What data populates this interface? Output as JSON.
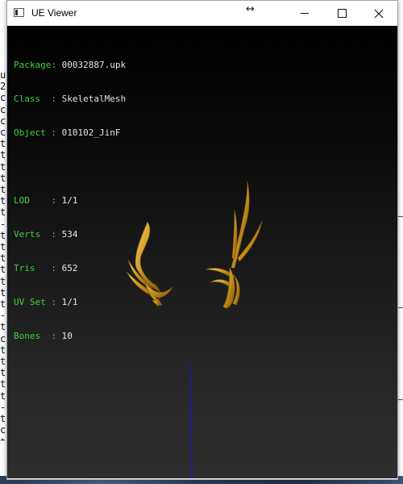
{
  "window": {
    "title": "UE Viewer",
    "resize_icon": "↔"
  },
  "background_console": {
    "lines": [
      "u",
      "2",
      "c",
      "c",
      "c",
      "c",
      "t",
      "t",
      "t",
      "t",
      "t",
      "t",
      "t",
      "-",
      "t",
      "t",
      "t",
      "t",
      "t",
      "t",
      "t",
      "-",
      "t",
      "c",
      "t",
      "t",
      "t",
      "t",
      "t",
      "-",
      "t",
      "c",
      "t",
      "t"
    ]
  },
  "info": {
    "package_label": "Package: ",
    "package_value": "00032887.upk",
    "class_label": "Class  : ",
    "class_value": "SkeletalMesh",
    "object_label": "Object : ",
    "object_value": "010102_JinF",
    "lod_label": "LOD    : ",
    "lod_value": "1/1",
    "verts_label": "Verts  : ",
    "verts_value": "534",
    "tris_label": "Tris   : ",
    "tris_value": "652",
    "uvset_label": "UV Set : ",
    "uvset_value": "1/1",
    "bones_label": "Bones  : ",
    "bones_value": "10"
  },
  "colors": {
    "label_green": "#3fd23f",
    "value_white": "#e6e6e6",
    "mesh_gold": "#d9a52a",
    "axis_blue": "#1a1aa8"
  }
}
